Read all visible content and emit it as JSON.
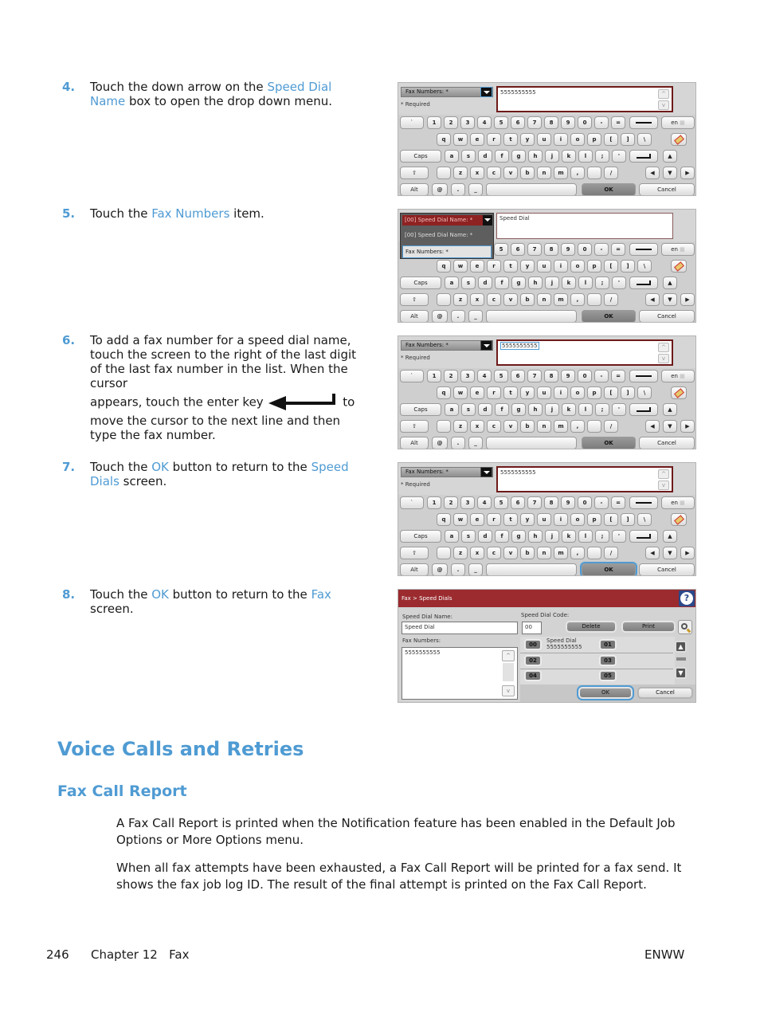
{
  "steps": [
    {
      "number": "4.",
      "parts": [
        "Touch the down arrow on the ",
        "Speed Dial Name",
        " box to open the drop down menu."
      ]
    },
    {
      "number": "5.",
      "parts": [
        "Touch the ",
        "Fax Numbers",
        " item."
      ]
    },
    {
      "number": "6.",
      "line1": "To add a fax number for a speed dial name, touch the screen to the right of the last digit of the last fax number in the list. When the cursor",
      "line2a": "appears, touch the enter key",
      "line2b": "to",
      "line3": "move the cursor to the next line and then type the fax number.",
      "icon": "enter-key-icon"
    },
    {
      "number": "7.",
      "parts": [
        "Touch the ",
        "OK",
        " button to return to the ",
        "Speed Dials",
        " screen."
      ]
    },
    {
      "number": "8.",
      "parts": [
        "Touch the ",
        "OK",
        " button to return to the ",
        "Fax",
        " screen."
      ]
    }
  ],
  "keyboard_panel": {
    "dropdown_label": "Fax Numbers: *",
    "required_note": "* Required",
    "entry_value": "5555555555",
    "keys_row1": [
      "`",
      "1",
      "2",
      "3",
      "4",
      "5",
      "6",
      "7",
      "8",
      "9",
      "0",
      "-",
      "="
    ],
    "keys_row2": [
      "q",
      "w",
      "e",
      "r",
      "t",
      "y",
      "u",
      "i",
      "o",
      "p",
      "[",
      "]",
      "\\"
    ],
    "keys_row3": [
      "a",
      "s",
      "d",
      "f",
      "g",
      "h",
      "j",
      "k",
      "l",
      ";",
      "'"
    ],
    "keys_row4": [
      "",
      "z",
      "x",
      "c",
      "v",
      "b",
      "n",
      "m",
      ",",
      "",
      "/"
    ],
    "caps_label": "Caps",
    "alt_label": "Alt",
    "at_label": "@",
    "dot_label": ".",
    "underscore_label": "_",
    "lang_label": "en",
    "ok_label": "OK",
    "cancel_label": "Cancel"
  },
  "dropdown_panel": {
    "selected": "[00] Speed Dial Name: *",
    "option1": "[00] Speed Dial Name: *",
    "option2": "Fax Numbers: *",
    "entry_value": "Speed Dial"
  },
  "speed_dials_screen": {
    "title": "Fax > Speed Dials",
    "help_icon": "?",
    "name_label": "Speed Dial Name:",
    "name_value": "Speed Dial",
    "code_label": "Speed Dial Code:",
    "code_value": "00",
    "delete_label": "Delete",
    "print_label": "Print",
    "fax_numbers_label": "Fax Numbers:",
    "fax_numbers_value": "5555555555",
    "entries": [
      {
        "code": "00",
        "name": "Speed Dial",
        "number": "5555555555"
      },
      {
        "code": "01",
        "name": "",
        "number": ""
      },
      {
        "code": "02",
        "name": "",
        "number": ""
      },
      {
        "code": "03",
        "name": "",
        "number": ""
      },
      {
        "code": "04",
        "name": "",
        "number": ""
      },
      {
        "code": "05",
        "name": "",
        "number": ""
      }
    ],
    "ok_label": "OK",
    "cancel_label": "Cancel"
  },
  "section": {
    "heading": "Voice Calls and Retries",
    "subheading": "Fax Call Report",
    "paragraphs": [
      "A Fax Call Report is printed when the Notification feature has been enabled in the Default Job Options or More Options menu.",
      "When all fax attempts have been exhausted, a Fax Call Report will be printed for a fax send. It shows the fax job log ID. The result of the final attempt is printed on the Fax Call Report."
    ]
  },
  "footer": {
    "page_number": "246",
    "chapter": "Chapter 12   Fax",
    "right": "ENWW"
  },
  "colors": {
    "accent_blue": "#4f9bd3",
    "title_bar_red": "#9b2b2f"
  }
}
